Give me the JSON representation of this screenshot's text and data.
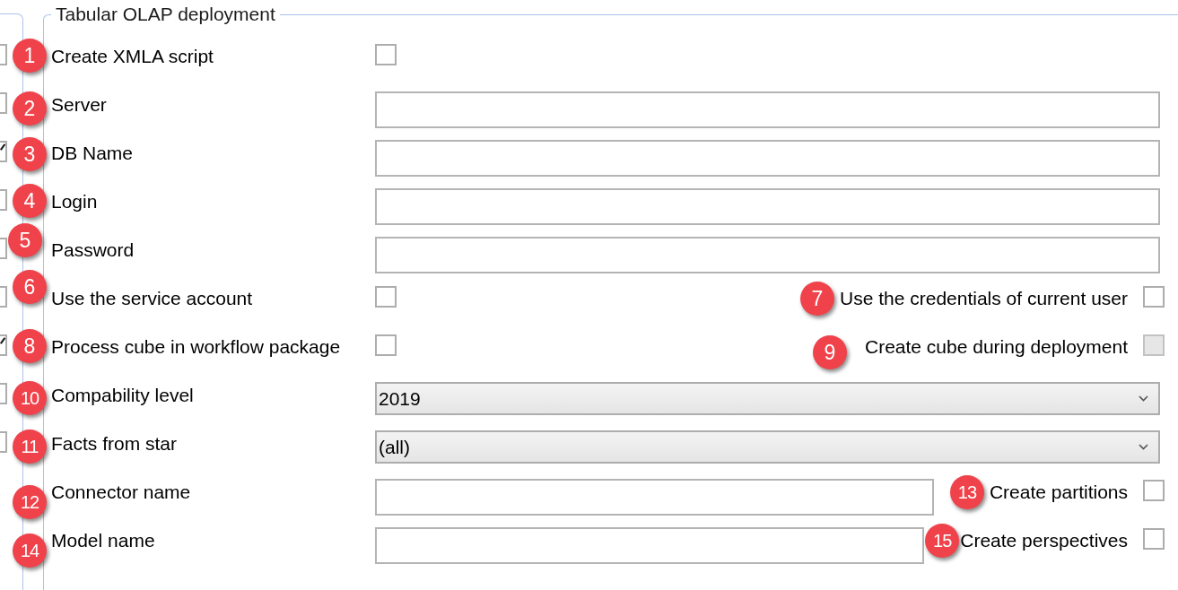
{
  "side_panel": {
    "checkboxes": [
      {
        "checked": false
      },
      {
        "checked": false
      },
      {
        "checked": true
      },
      {
        "checked": false
      },
      {
        "checked": false
      },
      {
        "checked": false
      },
      {
        "checked": true
      },
      {
        "checked": false
      },
      {
        "checked": false
      }
    ]
  },
  "group": {
    "title": "Tabular OLAP deployment",
    "rows": [
      {
        "label": "Create XMLA script",
        "badge": "1",
        "control": {
          "kind": "checkbox",
          "checked": false
        }
      },
      {
        "label": "Server",
        "badge": "2",
        "control": {
          "kind": "text"
        }
      },
      {
        "label": "DB Name",
        "badge": "3",
        "control": {
          "kind": "text"
        }
      },
      {
        "label": "Login",
        "badge": "4",
        "control": {
          "kind": "text"
        }
      },
      {
        "label": "Password",
        "badge": "5",
        "control": {
          "kind": "text"
        }
      },
      {
        "label": "Use the service account",
        "badge": "6",
        "control": {
          "kind": "checkbox",
          "checked": false
        },
        "extra": {
          "label": "Use the credentials of current user",
          "badge": "7",
          "checked": false,
          "disabled": false
        }
      },
      {
        "label": "Process cube in workflow package",
        "badge": "8",
        "control": {
          "kind": "checkbox",
          "checked": false
        },
        "extra": {
          "label": "Create cube during deployment",
          "badge": "9",
          "checked": false,
          "disabled": true
        }
      },
      {
        "label": "Compability level",
        "badge": "10",
        "control": {
          "kind": "dropdown",
          "value": "2019"
        }
      },
      {
        "label": "Facts from star",
        "badge": "11",
        "control": {
          "kind": "dropdown",
          "value": "(all)"
        }
      },
      {
        "label": "Connector name",
        "badge": "12",
        "control": {
          "kind": "text"
        },
        "extra": {
          "label": "Create partitions",
          "badge": "13",
          "checked": false,
          "disabled": false
        }
      },
      {
        "label": "Model name",
        "badge": "14",
        "control": {
          "kind": "text"
        },
        "extra": {
          "label": "Create perspectives",
          "badge": "15",
          "checked": false,
          "disabled": false
        }
      }
    ]
  }
}
